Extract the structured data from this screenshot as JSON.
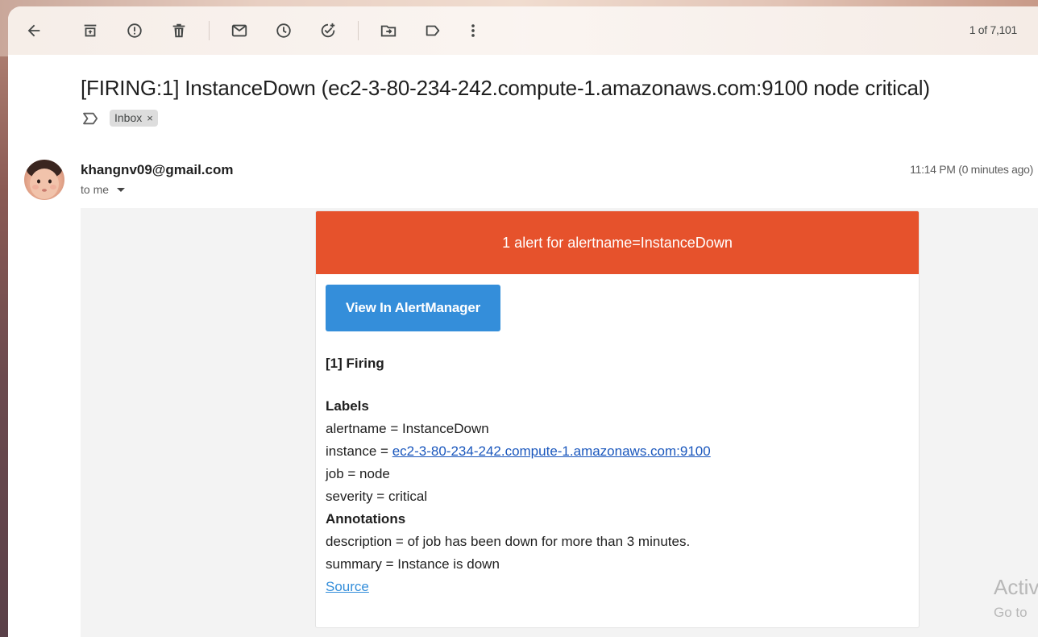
{
  "toolbar": {
    "back_icon": "arrow-left-icon",
    "archive_icon": "archive-icon",
    "report_spam_icon": "report-spam-icon",
    "delete_icon": "trash-icon",
    "mark_unread_icon": "mail-icon",
    "snooze_icon": "clock-icon",
    "add_task_icon": "add-task-icon",
    "move_to_icon": "move-to-folder-icon",
    "labels_icon": "label-icon",
    "more_icon": "more-vertical-icon",
    "pager": "1 of 7,101"
  },
  "message": {
    "subject": "[FIRING:1] InstanceDown (ec2-3-80-234-242.compute-1.amazonaws.com:9100 node critical)",
    "label_chip": "Inbox",
    "label_chip_remove": "×",
    "sender": "khangnv09@gmail.com",
    "recipient": "to me",
    "time": "11:14 PM (0 minutes ago)"
  },
  "alert": {
    "header": "1 alert for alertname=InstanceDown",
    "header_color": "#e6522c",
    "button": "View In AlertManager",
    "button_color": "#348eda",
    "firing_title": "[1] Firing",
    "labels_title": "Labels",
    "alertname_line": "alertname = InstanceDown",
    "instance_prefix": "instance = ",
    "instance_link": "ec2-3-80-234-242.compute-1.amazonaws.com:9100",
    "job_line": "job = node",
    "severity_line": "severity = critical",
    "annotations_title": "Annotations",
    "description_line": "description = of job has been down for more than 3 minutes.",
    "summary_line": "summary = Instance is down",
    "source_link": "Source"
  },
  "watermark": {
    "line1": "Activ",
    "line2": "Go to"
  }
}
